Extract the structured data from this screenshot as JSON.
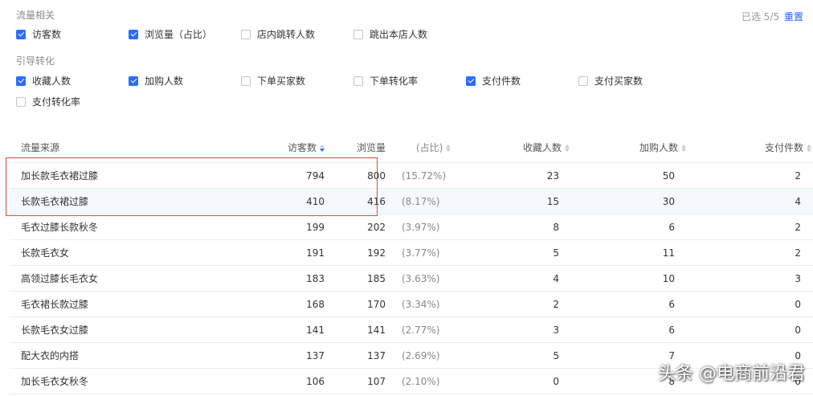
{
  "filters": {
    "traffic_title": "流量相关",
    "traffic": [
      {
        "label": "访客数",
        "checked": true
      },
      {
        "label": "浏览量（占比）",
        "checked": true
      },
      {
        "label": "店内跳转人数",
        "checked": false
      },
      {
        "label": "跳出本店人数",
        "checked": false
      }
    ],
    "conversion_title": "引导转化",
    "conversion": [
      {
        "label": "收藏人数",
        "checked": true
      },
      {
        "label": "加购人数",
        "checked": true
      },
      {
        "label": "下单买家数",
        "checked": false
      },
      {
        "label": "下单转化率",
        "checked": false
      },
      {
        "label": "支付件数",
        "checked": true
      },
      {
        "label": "支付买家数",
        "checked": false
      },
      {
        "label": "支付转化率",
        "checked": false
      }
    ],
    "selected_text": "已选 5/5",
    "reset_label": "重置"
  },
  "table": {
    "headers": {
      "source": "流量来源",
      "uv": "访客数",
      "pv": "浏览量",
      "pct": "(占比)",
      "fav": "收藏人数",
      "cart": "加购人数",
      "pay": "支付件数"
    },
    "rows": [
      {
        "source": "加长款毛衣裙过膝",
        "uv": "794",
        "pv": "800",
        "pct": "(15.72%)",
        "fav": "23",
        "cart": "50",
        "pay": "2"
      },
      {
        "source": "长款毛衣裙过膝",
        "uv": "410",
        "pv": "416",
        "pct": "(8.17%)",
        "fav": "15",
        "cart": "30",
        "pay": "4"
      },
      {
        "source": "毛衣过膝长款秋冬",
        "uv": "199",
        "pv": "202",
        "pct": "(3.97%)",
        "fav": "8",
        "cart": "6",
        "pay": "2"
      },
      {
        "source": "长款毛衣女",
        "uv": "191",
        "pv": "192",
        "pct": "(3.77%)",
        "fav": "5",
        "cart": "11",
        "pay": "2"
      },
      {
        "source": "高领过膝长毛衣女",
        "uv": "183",
        "pv": "185",
        "pct": "(3.63%)",
        "fav": "4",
        "cart": "10",
        "pay": "3"
      },
      {
        "source": "毛衣裙长款过膝",
        "uv": "168",
        "pv": "170",
        "pct": "(3.34%)",
        "fav": "2",
        "cart": "6",
        "pay": "0"
      },
      {
        "source": "长款毛衣女过膝",
        "uv": "141",
        "pv": "141",
        "pct": "(2.77%)",
        "fav": "3",
        "cart": "6",
        "pay": "0"
      },
      {
        "source": "配大衣的内搭",
        "uv": "137",
        "pv": "137",
        "pct": "(2.69%)",
        "fav": "5",
        "cart": "7",
        "pay": "0"
      },
      {
        "source": "加长毛衣女秋冬",
        "uv": "106",
        "pv": "107",
        "pct": "(2.10%)",
        "fav": "0",
        "cart": "8",
        "pay": "0"
      }
    ]
  },
  "watermark": "头条 @电商前沿君",
  "colors": {
    "accent": "#2b6cff",
    "highlight_box": "#e2473a",
    "row_highlight": "#f5f8ff"
  }
}
